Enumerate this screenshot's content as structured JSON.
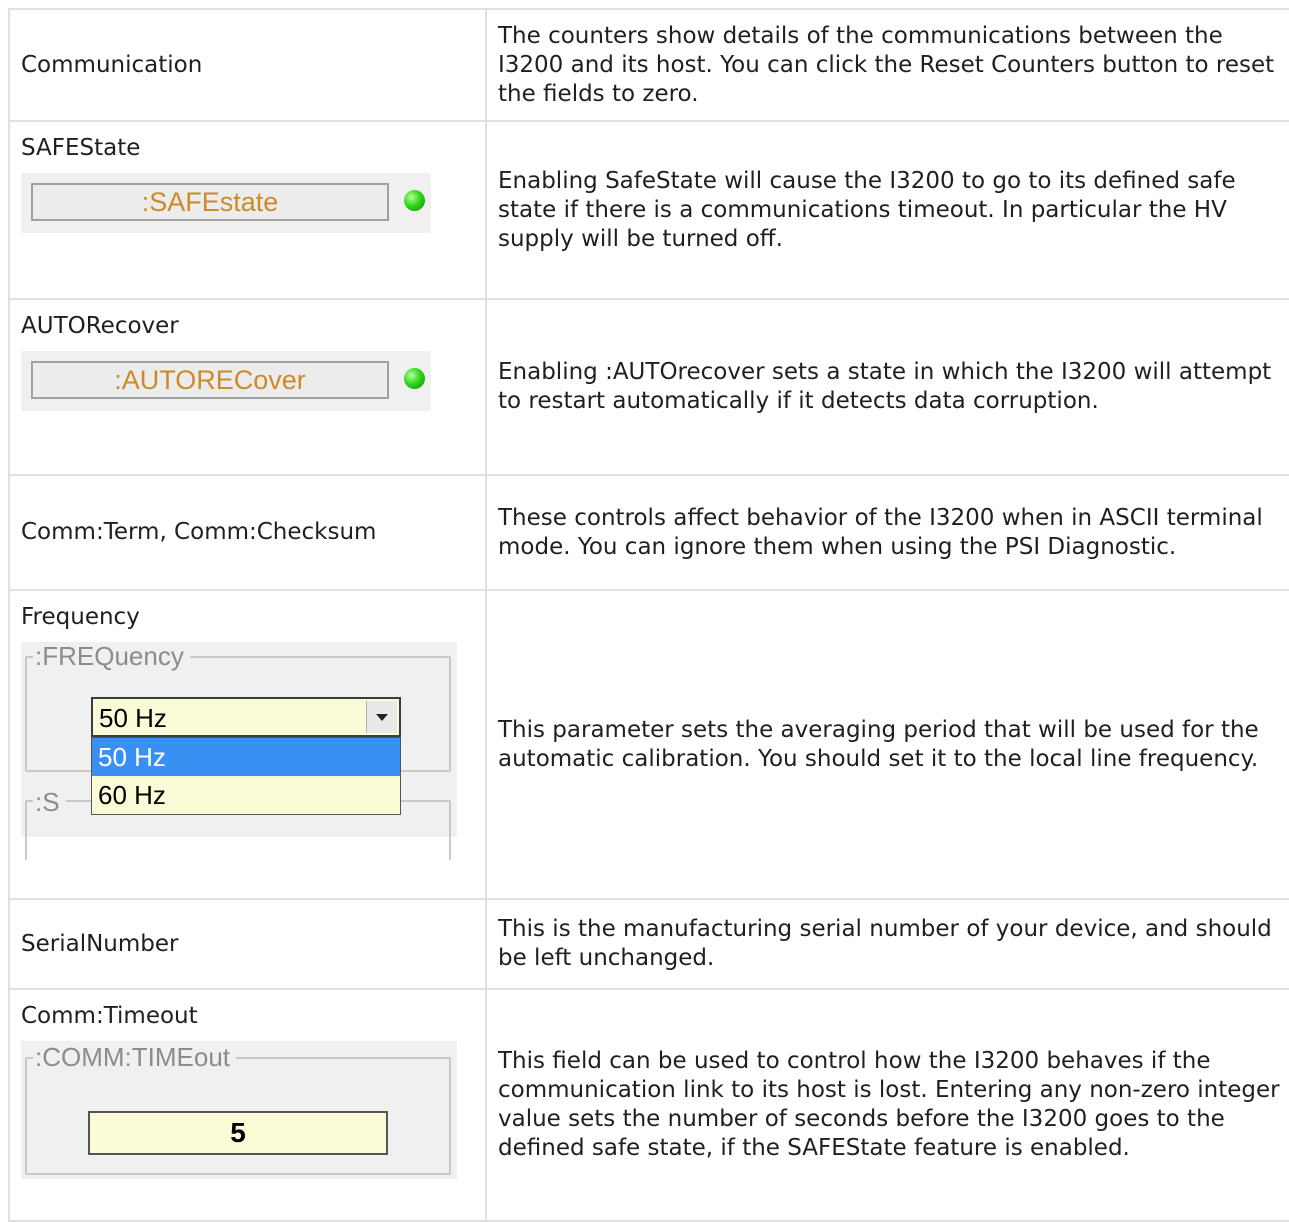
{
  "rows": [
    {
      "label": "Communication",
      "description": "The counters show details of the communications between the I3200 and its host.  You can click the Reset Counters button to reset the fields to zero."
    },
    {
      "label": "SAFEState",
      "control": {
        "button_label": ":SAFEstate",
        "indicator_color": "#2fd61c"
      },
      "description": "Enabling SafeState will cause the I3200 to go to its defined safe state if there is a communications timeout.  In particular the HV supply will be turned off."
    },
    {
      "label": "AUTORecover",
      "control": {
        "button_label": ":AUTORECover",
        "indicator_color": "#2fd61c"
      },
      "description": "Enabling :AUTOrecover sets a state in which the I3200 will attempt to restart automatically if it detects data corruption."
    },
    {
      "label": "Comm:Term, Comm:Checksum",
      "description": "These controls affect behavior of the I3200 when in ASCII terminal mode.  You can ignore them when using the PSI Diagnostic."
    },
    {
      "label": "Frequency",
      "control": {
        "group_title": ":FREQuency",
        "selected_value": "50 Hz",
        "options": [
          "50 Hz",
          "60 Hz"
        ],
        "highlighted_option": "50 Hz",
        "next_group_title_fragment": ":S"
      },
      "description": "This parameter sets the averaging period that will be used for the automatic calibration.  You should set it to the local line frequency."
    },
    {
      "label": "SerialNumber",
      "description": "This is the manufacturing serial number of your device, and should be left unchanged."
    },
    {
      "label": "Comm:Timeout",
      "control": {
        "group_title": ":COMM:TIMEout",
        "value": "5"
      },
      "description": "This field can be used to control how the I3200 behaves if the communication link to its host is lost.  Entering any non-zero integer value sets the number of seconds before the I3200 goes to the defined safe state, if the SAFEState feature is enabled."
    }
  ]
}
